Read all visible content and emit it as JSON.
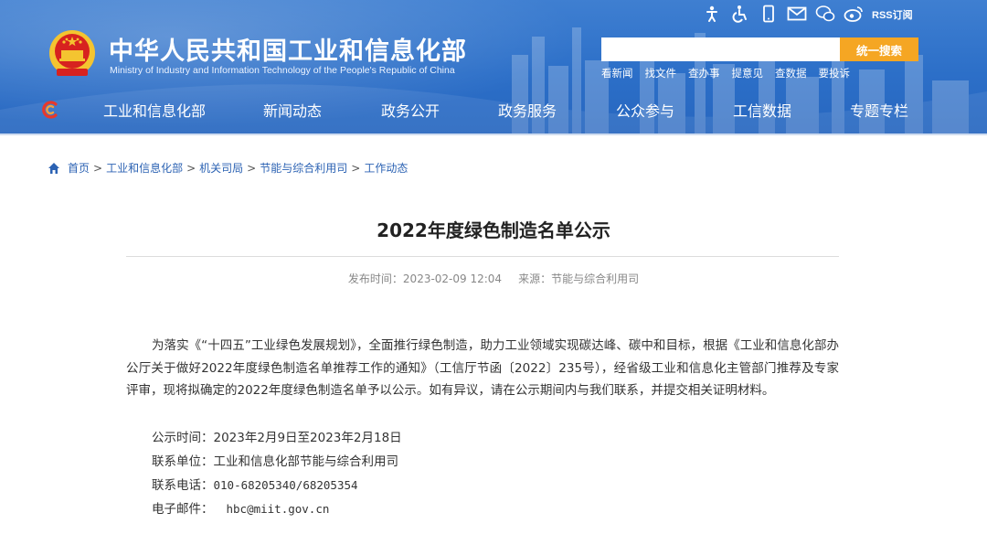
{
  "header": {
    "site_title": "中华人民共和国工业和信息化部",
    "site_subtitle": "Ministry of Industry and Information Technology of the People's Republic of China",
    "rss_label": "RSS订阅",
    "search": {
      "placeholder": "",
      "button_label": "统一搜索"
    },
    "quick_links": [
      "看新闻",
      "找文件",
      "查办事",
      "提意见",
      "查数据",
      "要投诉"
    ],
    "top_icons": [
      "accessibility-mode-icon",
      "wheelchair-icon",
      "mobile-icon",
      "mail-icon",
      "wechat-icon",
      "weibo-icon"
    ]
  },
  "nav": {
    "items": [
      "工业和信息化部",
      "新闻动态",
      "政务公开",
      "政务服务",
      "公众参与",
      "工信数据",
      "专题专栏"
    ]
  },
  "breadcrumb": {
    "items": [
      "首页",
      "工业和信息化部",
      "机关司局",
      "节能与综合利用司",
      "工作动态"
    ],
    "separator": ">"
  },
  "article": {
    "title": "2022年度绿色制造名单公示",
    "publish_label": "发布时间：2023-02-09 12:04",
    "source_label": "来源：节能与综合利用司",
    "body": "为落实《“十四五”工业绿色发展规划》，全面推行绿色制造，助力工业领域实现碳达峰、碳中和目标，根据《工业和信息化部办公厅关于做好2022年度绿色制造名单推荐工作的通知》（工信厅节函〔2022〕235号），经省级工业和信息化主管部门推荐及专家评审，现将拟确定的2022年度绿色制造名单予以公示。如有异议，请在公示期间内与我们联系，并提交相关证明材料。",
    "notice_period": "公示时间：2023年2月9日至2023年2月18日",
    "contact_unit": "联系单位：工业和信息化部节能与综合利用司",
    "contact_phone_label": "联系电话：",
    "contact_phone": "010-68205340/68205354",
    "email_label": "电子邮件：",
    "email": "hbc@miit.gov.cn"
  },
  "colors": {
    "header_blue": "#2c6fc8",
    "search_button": "#f5a623",
    "link_blue": "#2b62b3",
    "emblem_red": "#d7221f",
    "emblem_gold": "#f4c430"
  }
}
